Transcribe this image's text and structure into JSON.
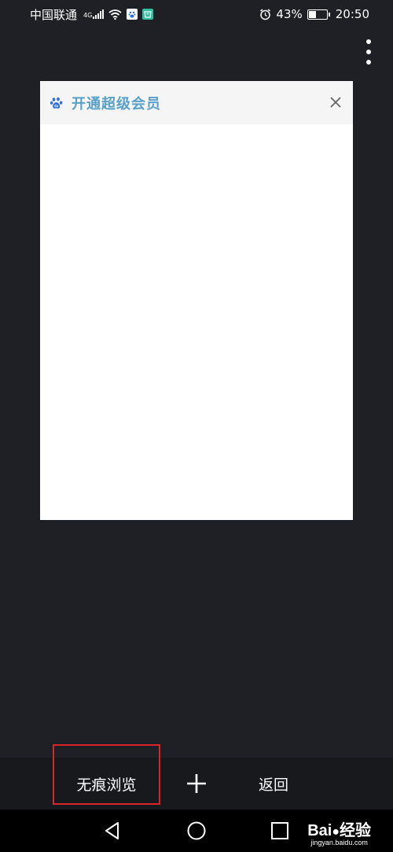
{
  "status_bar": {
    "carrier": "中国联通",
    "network_type": "4G",
    "battery_percent": "43%",
    "time": "20:50",
    "icons": [
      "signal-icon",
      "wifi-icon",
      "baidu-app-icon",
      "shop-app-icon",
      "alarm-icon",
      "battery-icon"
    ]
  },
  "tab_card": {
    "title": "开通超级会员",
    "title_color": "#5aa0c8",
    "favicon": "baidu-paw-icon",
    "close_icon": "close-icon"
  },
  "toolbar": {
    "incognito_label": "无痕浏览",
    "new_tab_icon": "plus-icon",
    "back_label": "返回",
    "highlight_color": "#d9262c"
  },
  "nav_bar": {
    "icons": [
      "back-triangle-icon",
      "home-circle-icon",
      "recents-square-icon"
    ]
  },
  "watermark": {
    "brand": "Bai",
    "brand_suffix": "经验",
    "url": "jingyan.baidu.com"
  }
}
